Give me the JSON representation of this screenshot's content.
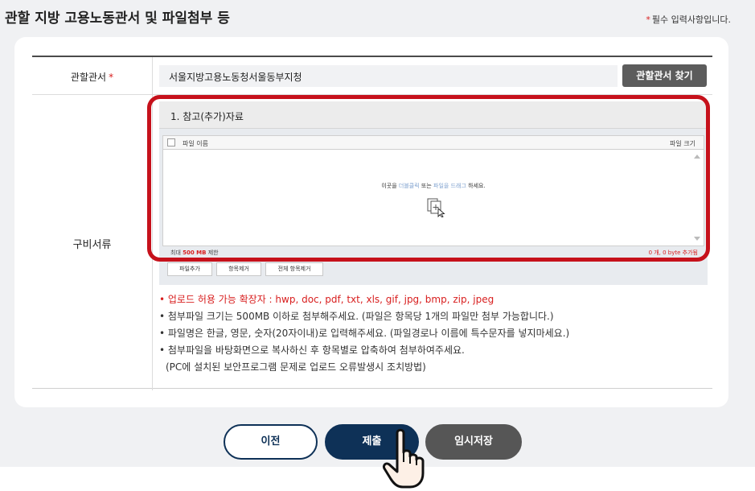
{
  "page": {
    "title": "관할 지방 고용노동관서 및 파일첨부 등",
    "required_note_star": "*",
    "required_note": "필수 입력사항입니다."
  },
  "office": {
    "label": "관할관서",
    "required_star": "*",
    "value": "서울지방고용노동청서울동부지청",
    "find_button": "관할관서 찾기"
  },
  "documents": {
    "label": "구비서류",
    "uploader": {
      "header": "1. 참고(추가)자료",
      "col_name": "파일 이름",
      "col_size": "파일 크기",
      "drop_hint_prefix": "이곳을",
      "drop_hint_dblclick": "더블클릭",
      "drop_hint_or": "또는",
      "drop_hint_drag": "파일을 드래그",
      "drop_hint_suffix": "하세요.",
      "limit_prefix": "최대",
      "limit_value": "500 MB",
      "limit_suffix": "제한",
      "count_status": "0 개, 0 byte 추가됨",
      "add_file": "파일추가",
      "remove_item": "항목제거",
      "remove_all": "전체 항목제거"
    },
    "notes": [
      "• 업로드 허용 가능 확장자 : hwp, doc, pdf, txt, xls, gif, jpg, bmp, zip, jpeg",
      "• 첨부파일 크기는 500MB 이하로 첨부해주세요. (파일은 항목당 1개의 파일만 첨부 가능합니다.)",
      "• 파일명은 한글, 영문, 숫자(20자이내)로 입력해주세요. (파일경로나 이름에 특수문자를 넣지마세요.)",
      "• 첨부파일을 바탕화면으로 복사하신 후 항목별로 압축하여 첨부하여주세요.",
      "(PC에 설치된 보안프로그램 문제로 업로드 오류발생시 조치방법)"
    ]
  },
  "actions": {
    "prev": "이전",
    "submit": "제출",
    "temp_save": "임시저장"
  },
  "colors": {
    "accent_navy": "#0e3157",
    "highlight_red": "#c6111b",
    "required_red": "#d81e1e",
    "temp_gray": "#565656"
  },
  "icons": {
    "drop": "file-drop-icon",
    "cursor": "hand-pointer-icon"
  }
}
